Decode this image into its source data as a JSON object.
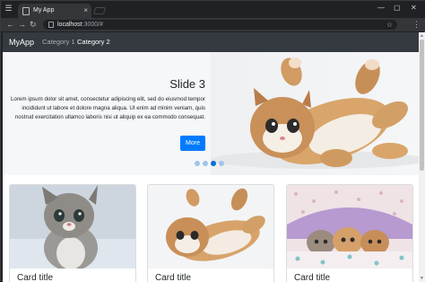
{
  "browser": {
    "tab_title": "My App",
    "tab_close": "×",
    "url_host": "localhost",
    "url_rest": ":3000/#",
    "back": "←",
    "forward": "→",
    "reload": "↻",
    "menu": "⋮",
    "window_minimize": "—",
    "window_maximize": "▢",
    "window_close": "✕",
    "bookmark": "☆"
  },
  "navbar": {
    "brand": "MyApp",
    "links": [
      {
        "label": "Category 1",
        "state": "muted"
      },
      {
        "label": "Category 2",
        "state": "active"
      }
    ]
  },
  "carousel": {
    "title": "Slide 3",
    "body": "Lorem ipsum dolor sit amet, consectetur adipiscing elit, sed do eiusmod tempor incididunt ut labore et dolore magna aliqua. Ut enim ad minim veniam, quis nostrud exercitation ullamco laboris nisi ut aliquip ex ea commodo consequat.",
    "button": "More",
    "slides_count": 4,
    "active_index": 2,
    "image_subject": "kitten-lying-on-back-image"
  },
  "cards": [
    {
      "title": "Card title",
      "image_subject": "grey-tabby-kitten-image"
    },
    {
      "title": "Card title",
      "image_subject": "orange-kitten-on-back-image"
    },
    {
      "title": "Card title",
      "image_subject": "kittens-under-blanket-image"
    }
  ],
  "colors": {
    "navbar_bg": "#343a40",
    "accent": "#007bff",
    "indicator": "#9fc3ec",
    "indicator_active": "#0b6fd6"
  }
}
